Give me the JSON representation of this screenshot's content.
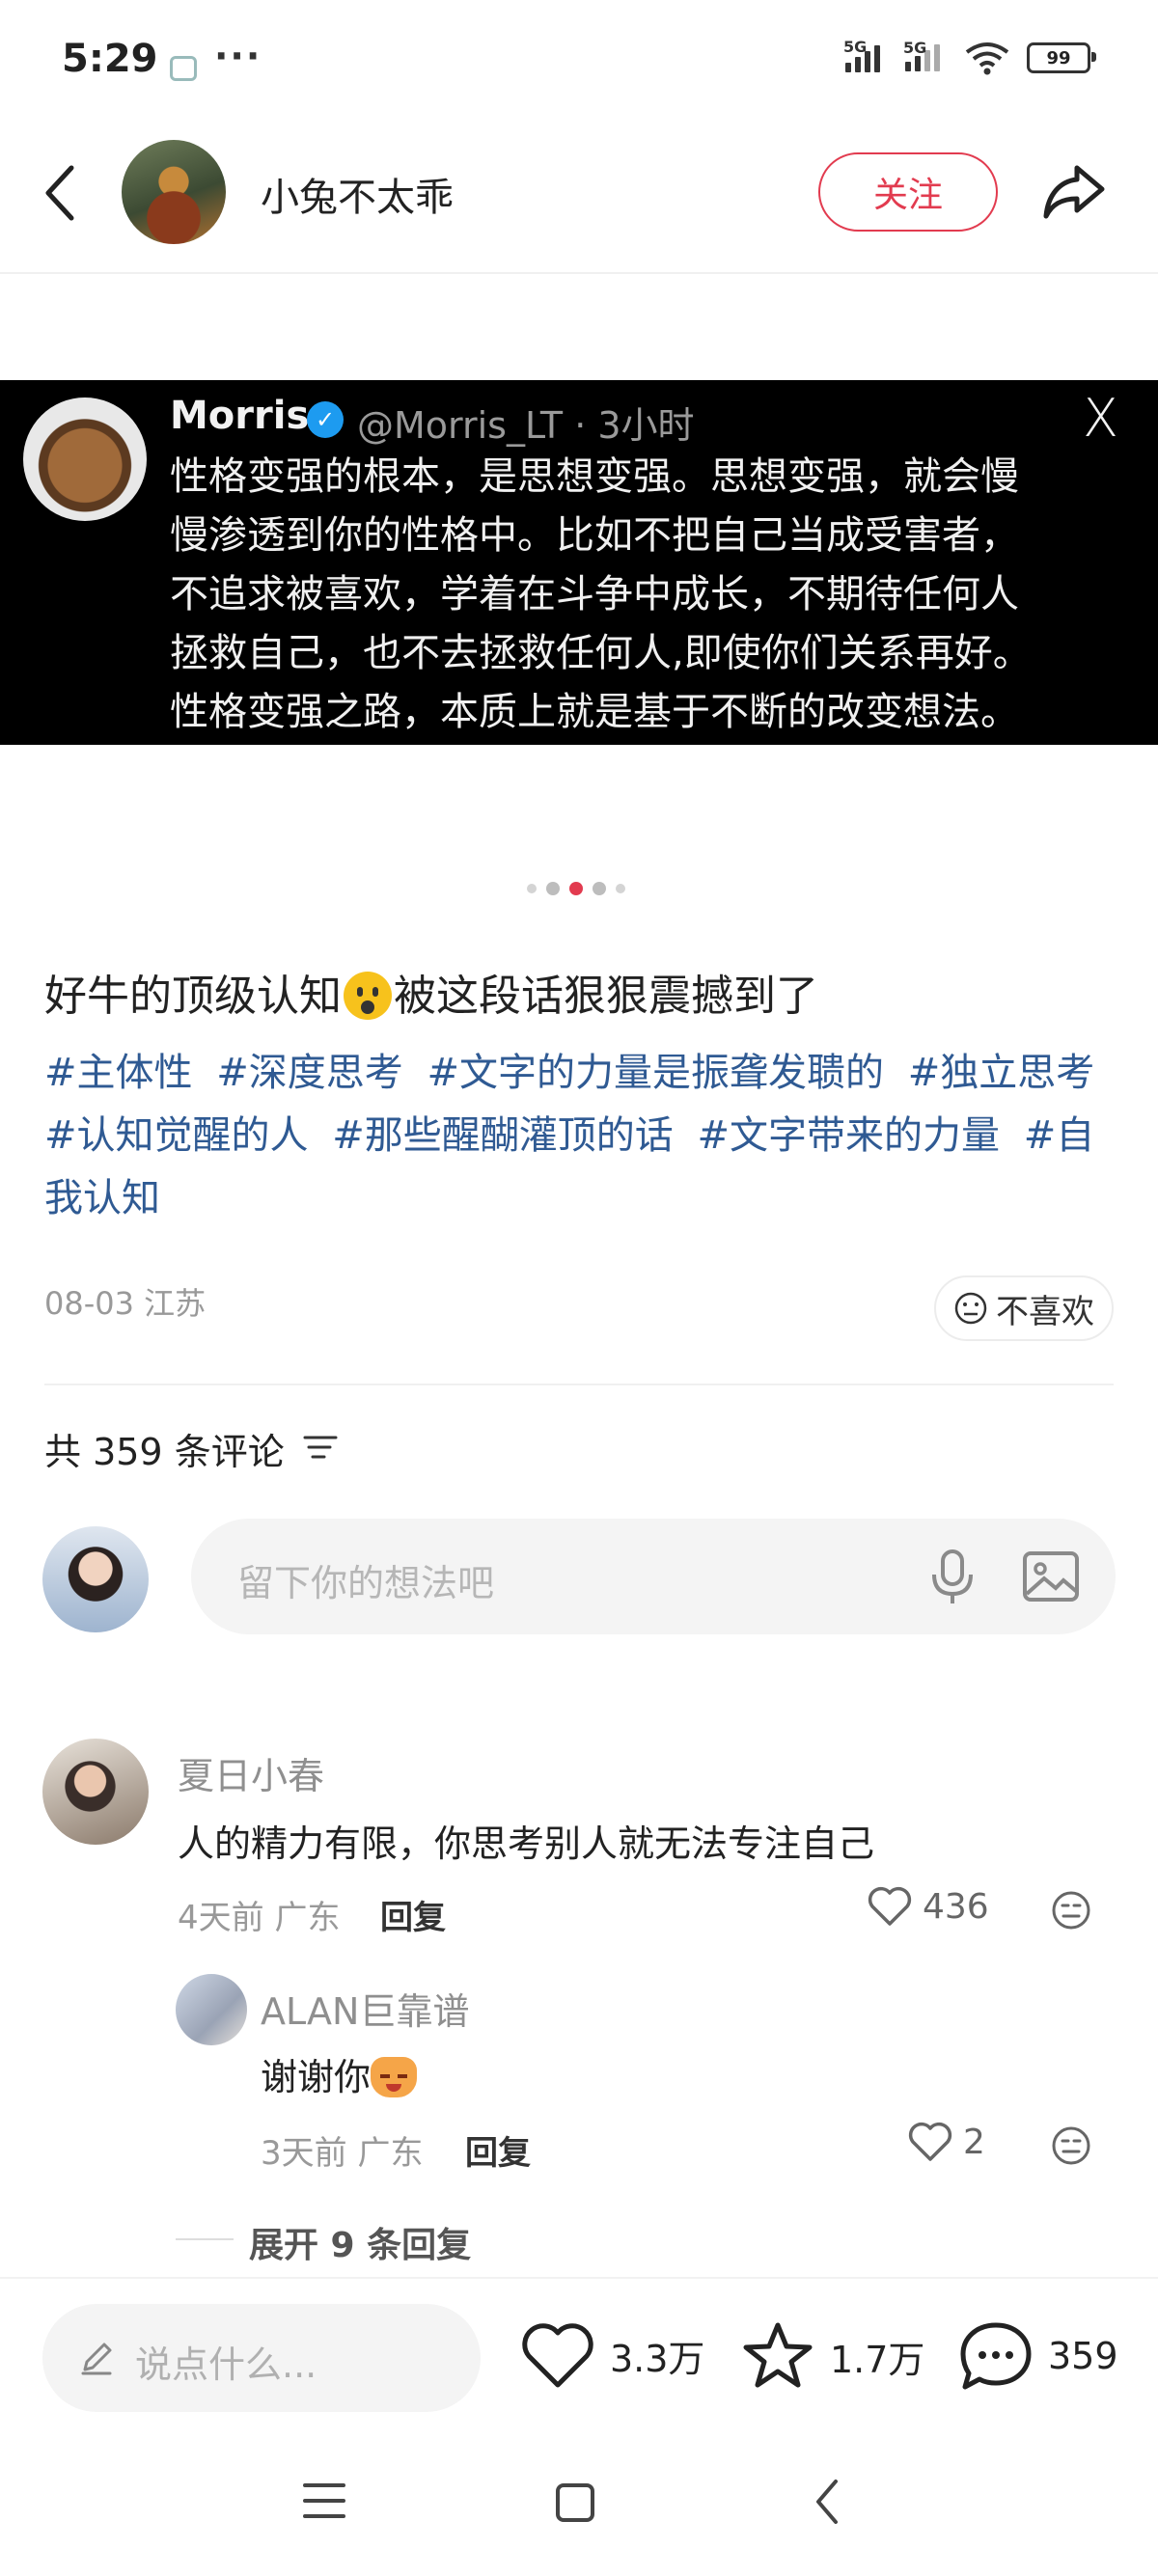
{
  "status": {
    "time": "5:29",
    "dots": "···",
    "signal1": "5G",
    "signal2": "5G",
    "battery": "99"
  },
  "header": {
    "author": "小兔不太乖",
    "follow": "关注"
  },
  "image": {
    "tweet_name": "Morris",
    "tweet_handle": "@Morris_LT · 3小时",
    "tweet_lines": [
      "性格变强的根本，是思想变强。思想变强，就会慢",
      "慢渗透到你的性格中。比如不把自己当成受害者，",
      "不追求被喜欢，学着在斗争中成长，不期待任何人",
      "拯救自己，也不去拯救任何人,即使你们关系再好。",
      "性格变强之路，本质上就是基于不断的改变想法。"
    ],
    "x_logo": "X"
  },
  "post": {
    "title_a": "好牛的顶级认知",
    "title_b": "被这段话狠狠震撼到了",
    "tags": [
      "#主体性",
      "#深度思考",
      "#文字的力量是振聋发聩的",
      "#独立思考",
      "#认知觉醒的人",
      "#那些醒醐灌顶的话",
      "#文字带来的力量",
      "#自我认知"
    ],
    "meta": "08-03 江苏",
    "dislike": "不喜欢"
  },
  "comments_header": {
    "count": "共 359 条评论"
  },
  "comment_input": {
    "placeholder": "留下你的想法吧"
  },
  "comments": [
    {
      "name": "夏日小春",
      "text": "人的精力有限，你思考别人就无法专注自己",
      "meta": "4天前 广东",
      "reply": "回复",
      "likes": "436"
    },
    {
      "name": "ALAN巨靠谱",
      "text": "谢谢你",
      "meta": "3天前 广东",
      "reply": "回复",
      "likes": "2"
    }
  ],
  "expand": "展开 9 条回复",
  "bottom": {
    "say": "说点什么...",
    "likes": "3.3万",
    "stars": "1.7万",
    "comments": "359"
  },
  "colors": {
    "accent": "#e23b4f",
    "tag": "#2f5a93"
  }
}
